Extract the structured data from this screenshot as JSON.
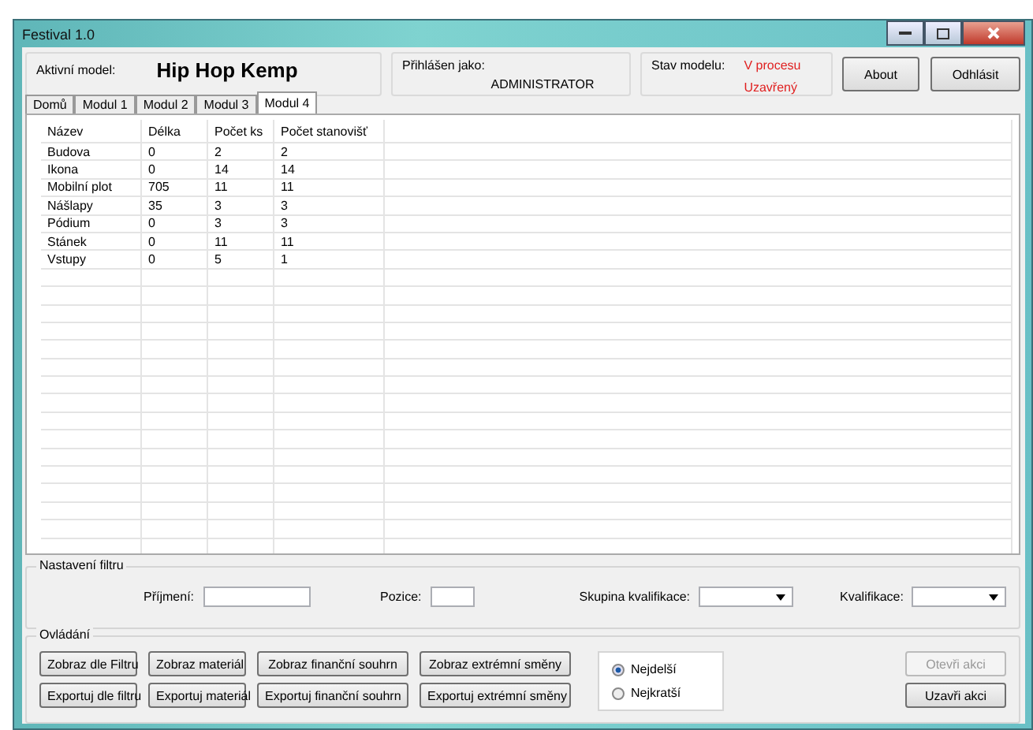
{
  "window": {
    "title": "Festival 1.0"
  },
  "header": {
    "model_label": "Aktivní model:",
    "model_name": "Hip Hop Kemp",
    "login_label": "Přihlášen jako:",
    "login_user": "ADMINISTRATOR",
    "status_label": "Stav modelu:",
    "status_values": [
      "V procesu",
      "Uzavřený"
    ],
    "buttons": [
      "About",
      "Odhlásit"
    ]
  },
  "tabs": [
    {
      "label": "Domů",
      "selected": false
    },
    {
      "label": "Modul 1",
      "selected": false
    },
    {
      "label": "Modul 2",
      "selected": false
    },
    {
      "label": "Modul 3",
      "selected": false
    },
    {
      "label": "Modul 4",
      "selected": true
    }
  ],
  "table": {
    "columns": [
      "Název",
      "Délka",
      "Počet ks",
      "Počet stanovišť"
    ],
    "rows": [
      [
        "Budova",
        "0",
        "2",
        "2"
      ],
      [
        "Ikona",
        "0",
        "14",
        "14"
      ],
      [
        "Mobilní plot",
        "705",
        "11",
        "11"
      ],
      [
        "Nášlapy",
        "35",
        "3",
        "3"
      ],
      [
        "Pódium",
        "0",
        "3",
        "3"
      ],
      [
        "Stánek",
        "0",
        "11",
        "11"
      ],
      [
        "Vstupy",
        "0",
        "5",
        "1"
      ]
    ]
  },
  "filter": {
    "title": "Nastavení filtru",
    "fields": [
      {
        "label": "Příjmení:",
        "kind": "text"
      },
      {
        "label": "Pozice:",
        "kind": "short"
      },
      {
        "label": "Skupina kvalifikace:",
        "kind": "combo"
      },
      {
        "label": "Kvalifikace:",
        "kind": "combo"
      }
    ]
  },
  "controls": {
    "title": "Ovládání",
    "buttons": [
      [
        "Zobraz dle Filtru",
        "Exportuj dle filtru"
      ],
      [
        "Zobraz materiál",
        "Exportuj materiál"
      ],
      [
        "Zobraz finanční souhrn",
        "Exportuj finanční souhrn"
      ],
      [
        "Zobraz extrémní směny",
        "Exportuj extrémní směny"
      ]
    ],
    "radios": [
      {
        "label": "Nejdelší",
        "selected": true
      },
      {
        "label": "Nejkratší",
        "selected": false
      }
    ],
    "actions": [
      {
        "label": "Otevři akci",
        "disabled": true
      },
      {
        "label": "Uzavři akci",
        "disabled": false
      }
    ]
  }
}
